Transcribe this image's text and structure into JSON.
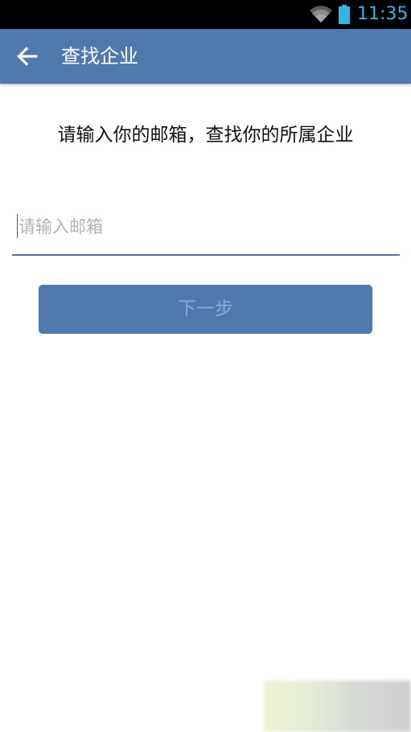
{
  "status_bar": {
    "time": "11:35",
    "wifi_icon": "wifi-icon",
    "battery_icon": "battery-icon",
    "accent_color": "#33b5e5"
  },
  "app_bar": {
    "back_icon": "arrow-left-icon",
    "title": "查找企业",
    "color": "#5079ae"
  },
  "main": {
    "prompt": "请输入你的邮箱，查找你的所属企业",
    "email_field": {
      "value": "",
      "placeholder": "请输入邮箱"
    },
    "next_button_label": "下一步"
  }
}
